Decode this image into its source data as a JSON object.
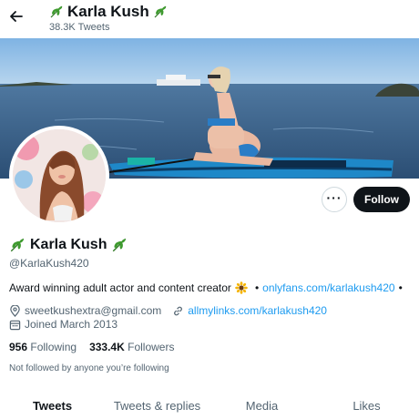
{
  "header": {
    "name": "Karla Kush",
    "tweet_count": "38.3K Tweets"
  },
  "actions": {
    "more_label": "···",
    "follow_label": "Follow"
  },
  "profile": {
    "name": "Karla Kush",
    "handle": "@KarlaKush420",
    "bio_text": "Award winning adult actor and content creator",
    "bio_link1": "onlyfans.com/karlakush420",
    "bio_sep1": "•",
    "bio_sep2": "•",
    "email": "sweetkushextra@gmail.com",
    "website": "allmylinks.com/karlakush420",
    "joined": "Joined March 2013",
    "following_count": "956",
    "following_label": "Following",
    "followers_count": "333.4K",
    "followers_label": "Followers",
    "not_followed": "Not followed by anyone you’re following"
  },
  "tabs": [
    {
      "label": "Tweets",
      "active": true
    },
    {
      "label": "Tweets & replies",
      "active": false
    },
    {
      "label": "Media",
      "active": false
    },
    {
      "label": "Likes",
      "active": false
    }
  ],
  "colors": {
    "accent": "#1d9bf0",
    "follow_bg": "#0f1419",
    "muted_text": "#536471",
    "leaf": "#3f9b2f"
  },
  "icons": [
    "back-arrow-icon",
    "leaf-icon",
    "more-icon",
    "sunflower-icon",
    "location-icon",
    "link-icon",
    "calendar-icon"
  ]
}
